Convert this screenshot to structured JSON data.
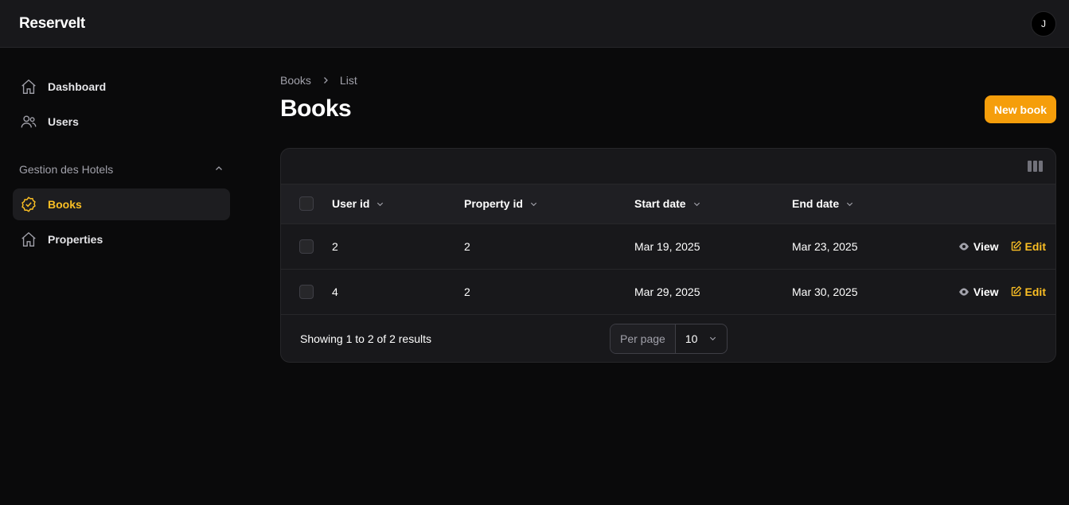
{
  "app": {
    "brand": "ReserveIt",
    "user_initial": "J"
  },
  "sidebar": {
    "items": [
      {
        "label": "Dashboard",
        "icon": "home-icon"
      },
      {
        "label": "Users",
        "icon": "users-icon"
      }
    ],
    "group": {
      "label": "Gestion des Hotels",
      "items": [
        {
          "label": "Books",
          "icon": "check-badge-icon",
          "active": true
        },
        {
          "label": "Properties",
          "icon": "home-icon"
        }
      ]
    }
  },
  "breadcrumb": {
    "parent": "Books",
    "current": "List"
  },
  "page": {
    "title": "Books",
    "new_button": "New book"
  },
  "table": {
    "columns": [
      "User id",
      "Property id",
      "Start date",
      "End date"
    ],
    "rows": [
      {
        "user_id": "2",
        "property_id": "2",
        "start_date": "Mar 19, 2025",
        "end_date": "Mar 23, 2025"
      },
      {
        "user_id": "4",
        "property_id": "2",
        "start_date": "Mar 29, 2025",
        "end_date": "Mar 30, 2025"
      }
    ],
    "actions": {
      "view": "View",
      "edit": "Edit"
    }
  },
  "pagination": {
    "summary": "Showing 1 to 2 of 2 results",
    "per_page_label": "Per page",
    "per_page_value": "10"
  },
  "colors": {
    "accent": "#f59e0b",
    "accent_text": "#fbbf24",
    "background": "#0a0a0b",
    "surface": "#18181b"
  }
}
